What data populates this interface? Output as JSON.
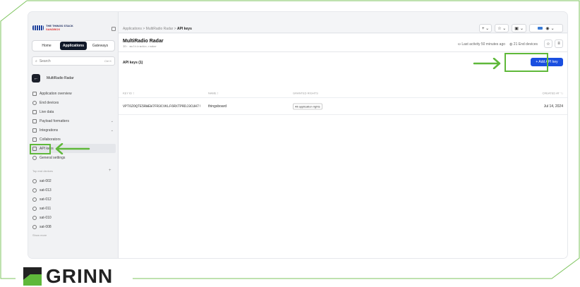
{
  "logo": {
    "line1": "THE THINGS STACK",
    "line2": "SANDBOX"
  },
  "tabs": [
    "Home",
    "Applications",
    "Gateways"
  ],
  "search": {
    "placeholder": "Search",
    "shortcut": "Ctrl K"
  },
  "app": {
    "back_icon": "arrow-left-icon",
    "name": "MultiRadio Radar"
  },
  "nav": [
    {
      "label": "Application overview",
      "icon": "grid-icon"
    },
    {
      "label": "End devices",
      "icon": "device-icon"
    },
    {
      "label": "Live data",
      "icon": "list-icon"
    },
    {
      "label": "Payload formatters",
      "icon": "code-icon",
      "chevron": "⌄"
    },
    {
      "label": "Integrations",
      "icon": "integration-icon",
      "chevron": "⌄"
    },
    {
      "label": "Collaborators",
      "icon": "people-icon"
    },
    {
      "label": "API keys",
      "icon": "key-icon"
    },
    {
      "label": "General settings",
      "icon": "gear-icon"
    }
  ],
  "top_devices": {
    "label": "Top end devices",
    "plus": "+",
    "items": [
      "sat-002",
      "sat-013",
      "sat-012",
      "sat-011",
      "sat-010",
      "sat-008"
    ],
    "show_more": "Show more"
  },
  "breadcrumb": {
    "part1": "Applications",
    "sep": ">",
    "part2": "MultiRadio Radar",
    "part3": "API keys"
  },
  "topbar": {
    "add": "+ ⌄",
    "star": "☆ ⌄",
    "notif": "⌄",
    "profile": "⌄"
  },
  "header": {
    "title": "MultiRadio Radar",
    "id": "ID: multiradio-radar",
    "activity": "Last activity 50 minutes ago",
    "devices": "21 End devices"
  },
  "content": {
    "count": "API keys (1)",
    "add_button": "+ Add API key",
    "columns": [
      "KEY ID ↕",
      "NAME ↕",
      "GRANTED RIGHTS",
      "CREATED AT ↑↓"
    ],
    "rows": [
      {
        "key_id": "VPTOZOQTE5RWEW7FR3CVKLF6RXTPRDJ3CUH7!",
        "name": "thingsboard",
        "rights": "All application rights",
        "created": "Jul 14, 2024"
      }
    ]
  },
  "brand": {
    "name": "GRINN"
  },
  "colors": {
    "highlight": "#5fb83a",
    "primary": "#1a4fe0",
    "brand_green": "#5fb83a"
  }
}
